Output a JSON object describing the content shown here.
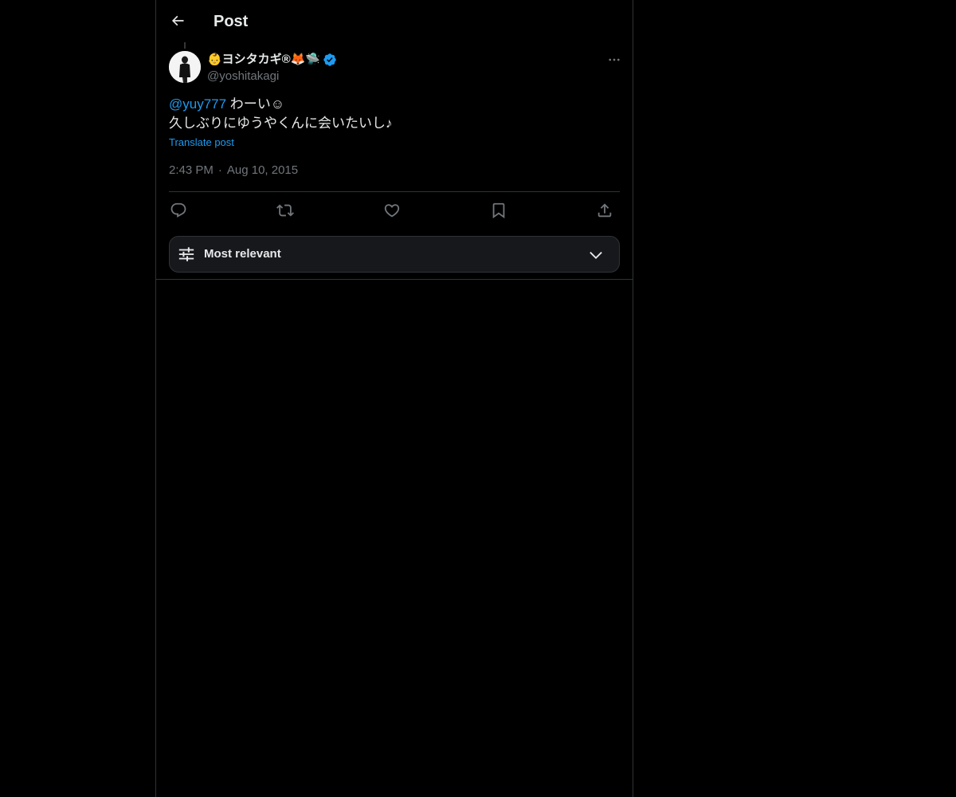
{
  "header": {
    "title": "Post",
    "back_icon": "arrow-left-icon"
  },
  "author": {
    "display_name": "👶ヨシタカギ®🦊🛸",
    "handle": "@yoshitakagi",
    "verified": true,
    "verified_color": "#1d9bf0"
  },
  "tweet": {
    "mention": "@yuy777",
    "line1_rest": " わーい☺",
    "line2": "久しぶりにゆうやくんに会いたいし♪",
    "translate_label": "Translate post",
    "time": "2:43 PM",
    "separator": "·",
    "date": "Aug 10, 2015"
  },
  "actions": [
    {
      "name": "reply",
      "icon": "reply-icon"
    },
    {
      "name": "repost",
      "icon": "repost-icon"
    },
    {
      "name": "like",
      "icon": "heart-icon"
    },
    {
      "name": "bookmark",
      "icon": "bookmark-icon"
    },
    {
      "name": "share",
      "icon": "share-icon"
    }
  ],
  "sort": {
    "label": "Most relevant",
    "icon": "sliders-icon",
    "chevron": "chevron-down-icon"
  },
  "colors": {
    "background": "#000000",
    "text": "#e7e9ea",
    "secondary": "#71767b",
    "accent": "#1d9bf0",
    "border": "#2f3336"
  }
}
